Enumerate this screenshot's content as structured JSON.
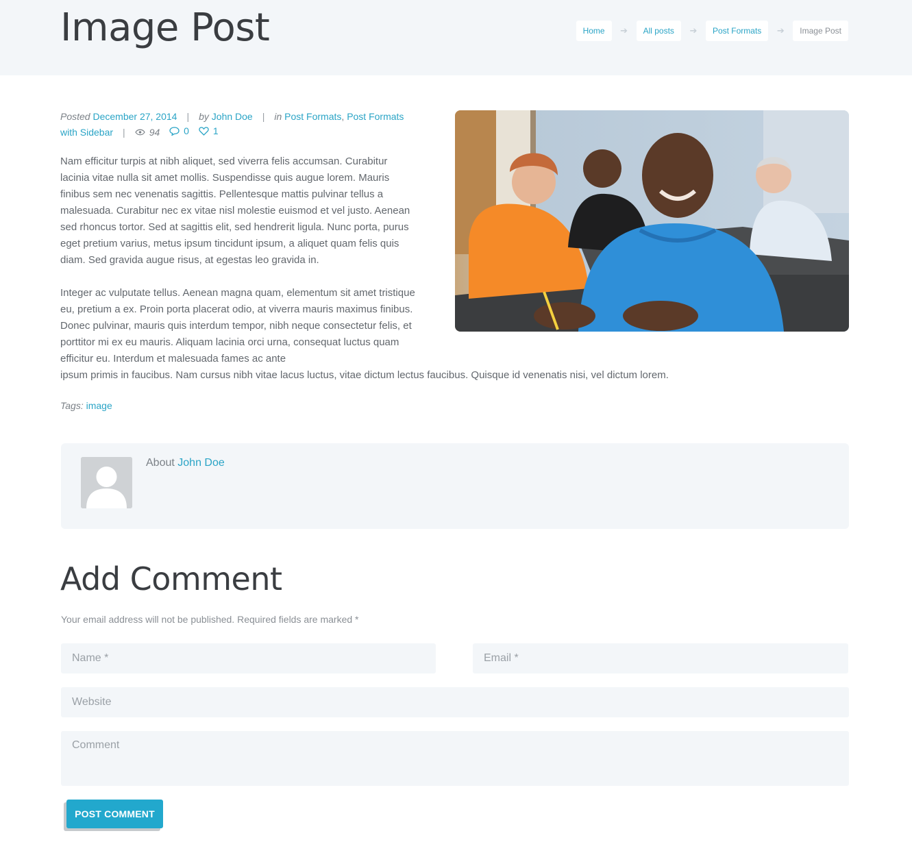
{
  "header": {
    "title": "Image Post",
    "breadcrumbs": [
      {
        "label": "Home"
      },
      {
        "label": "All posts"
      },
      {
        "label": "Post Formats"
      },
      {
        "label": "Image Post"
      }
    ]
  },
  "meta": {
    "posted_label": "Posted",
    "date": "December 27, 2014",
    "by_label": "by",
    "author": "John Doe",
    "in_label": "in",
    "category_1": "Post Formats",
    "category_2": "Post Formats with Sidebar",
    "views": "94",
    "comments": "0",
    "likes": "1"
  },
  "content": {
    "paragraph_1": "Nam efficitur turpis at nibh aliquet, sed viverra felis accumsan. Curabitur lacinia vitae nulla sit amet mollis. Suspendisse quis augue lorem. Mauris finibus sem nec venenatis sagittis. Pellentesque mattis pulvinar tellus a malesuada. Curabitur nec ex vitae nisl molestie euismod et vel justo. Aenean sed rhoncus tortor. Sed at sagittis elit, sed hendrerit ligula. Nunc porta, purus eget pretium varius, metus ipsum tincidunt ipsum, a aliquet quam felis quis diam. Sed gravida augue risus, at egestas leo gravida in.",
    "paragraph_2a": "Integer ac vulputate tellus. Aenean magna quam, elementum sit amet tristique eu, pretium a ex. Proin porta placerat odio, at viverra mauris maximus finibus. Donec pulvinar, mauris quis interdum tempor, nibh neque consectetur felis, et porttitor mi ex eu mauris. Aliquam lacinia orci urna, consequat luctus quam efficitur eu. Interdum et malesuada fames ac ante",
    "paragraph_2b": "ipsum primis in faucibus. Nam cursus nibh vitae lacus luctus, vitae dictum lectus faucibus. Quisque id venenatis nisi, vel dictum lorem."
  },
  "tags": {
    "label": "Tags:",
    "items": [
      "image"
    ]
  },
  "author_box": {
    "about_label": "About",
    "author": "John Doe"
  },
  "comment_form": {
    "title": "Add Comment",
    "note": "Your email address will not be published. Required fields are marked *",
    "name_placeholder": "Name *",
    "email_placeholder": "Email *",
    "website_placeholder": "Website",
    "comment_placeholder": "Comment",
    "submit_label": "POST COMMENT"
  },
  "icons": {
    "breadcrumb_separator": "arrow-right-icon",
    "views": "eye-icon",
    "comments": "speech-bubble-icon",
    "likes": "heart-icon",
    "avatar": "default-user-avatar"
  },
  "colors": {
    "accent": "#2aa4c6",
    "button": "#22a8cd",
    "panel_background": "#f3f6f9",
    "heading": "#3a3d41",
    "text": "#62676d"
  }
}
